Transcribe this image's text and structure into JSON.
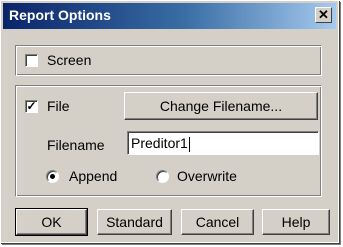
{
  "window": {
    "title": "Report Options",
    "close_glyph": "✕"
  },
  "screen_option": {
    "label": "Screen",
    "checked": false
  },
  "file_option": {
    "label": "File",
    "checked": true,
    "check_glyph": "✓",
    "change_filename_label": "Change Filename...",
    "filename_label": "Filename",
    "filename_value": "Preditor1"
  },
  "write_mode": {
    "append_label": "Append",
    "overwrite_label": "Overwrite",
    "selected": "Append"
  },
  "buttons": {
    "ok": "OK",
    "standard": "Standard",
    "cancel": "Cancel",
    "help": "Help"
  },
  "colors": {
    "face": "#d4d0c8",
    "title_start": "#0a246a",
    "title_end": "#a6caf0"
  }
}
